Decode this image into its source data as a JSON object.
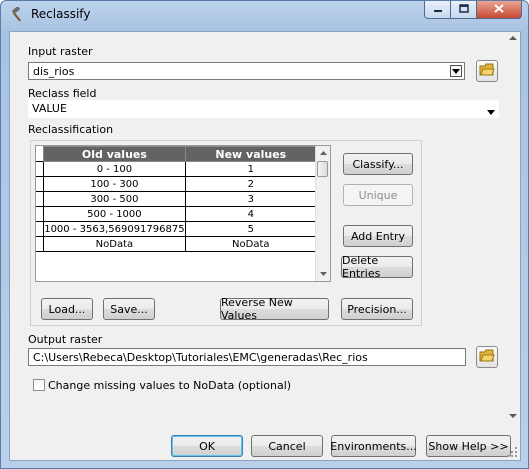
{
  "window": {
    "title": "Reclassify"
  },
  "input_raster": {
    "label": "Input raster",
    "value": "dis_rios"
  },
  "reclass_field": {
    "label": "Reclass field",
    "value": "VALUE"
  },
  "reclassification": {
    "label": "Reclassification",
    "columns": [
      "Old values",
      "New values"
    ],
    "rows": [
      {
        "old": "0 - 100",
        "new": "1"
      },
      {
        "old": "100 - 300",
        "new": "2"
      },
      {
        "old": "300 - 500",
        "new": "3"
      },
      {
        "old": "500 - 1000",
        "new": "4"
      },
      {
        "old": "1000 - 3563,569091796875",
        "new": "5"
      },
      {
        "old": "NoData",
        "new": "NoData"
      }
    ],
    "buttons": {
      "classify": "Classify...",
      "unique": "Unique",
      "add_entry": "Add Entry",
      "delete_entries": "Delete Entries",
      "load": "Load...",
      "save": "Save...",
      "reverse": "Reverse New Values",
      "precision": "Precision..."
    }
  },
  "output_raster": {
    "label": "Output raster",
    "value": "C:\\Users\\Rebeca\\Desktop\\Tutoriales\\EMC\\generadas\\Rec_rios"
  },
  "change_missing": {
    "label": "Change missing values to NoData (optional)",
    "checked": false
  },
  "footer": {
    "ok": "OK",
    "cancel": "Cancel",
    "environments": "Environments...",
    "show_help": "Show Help >>"
  }
}
